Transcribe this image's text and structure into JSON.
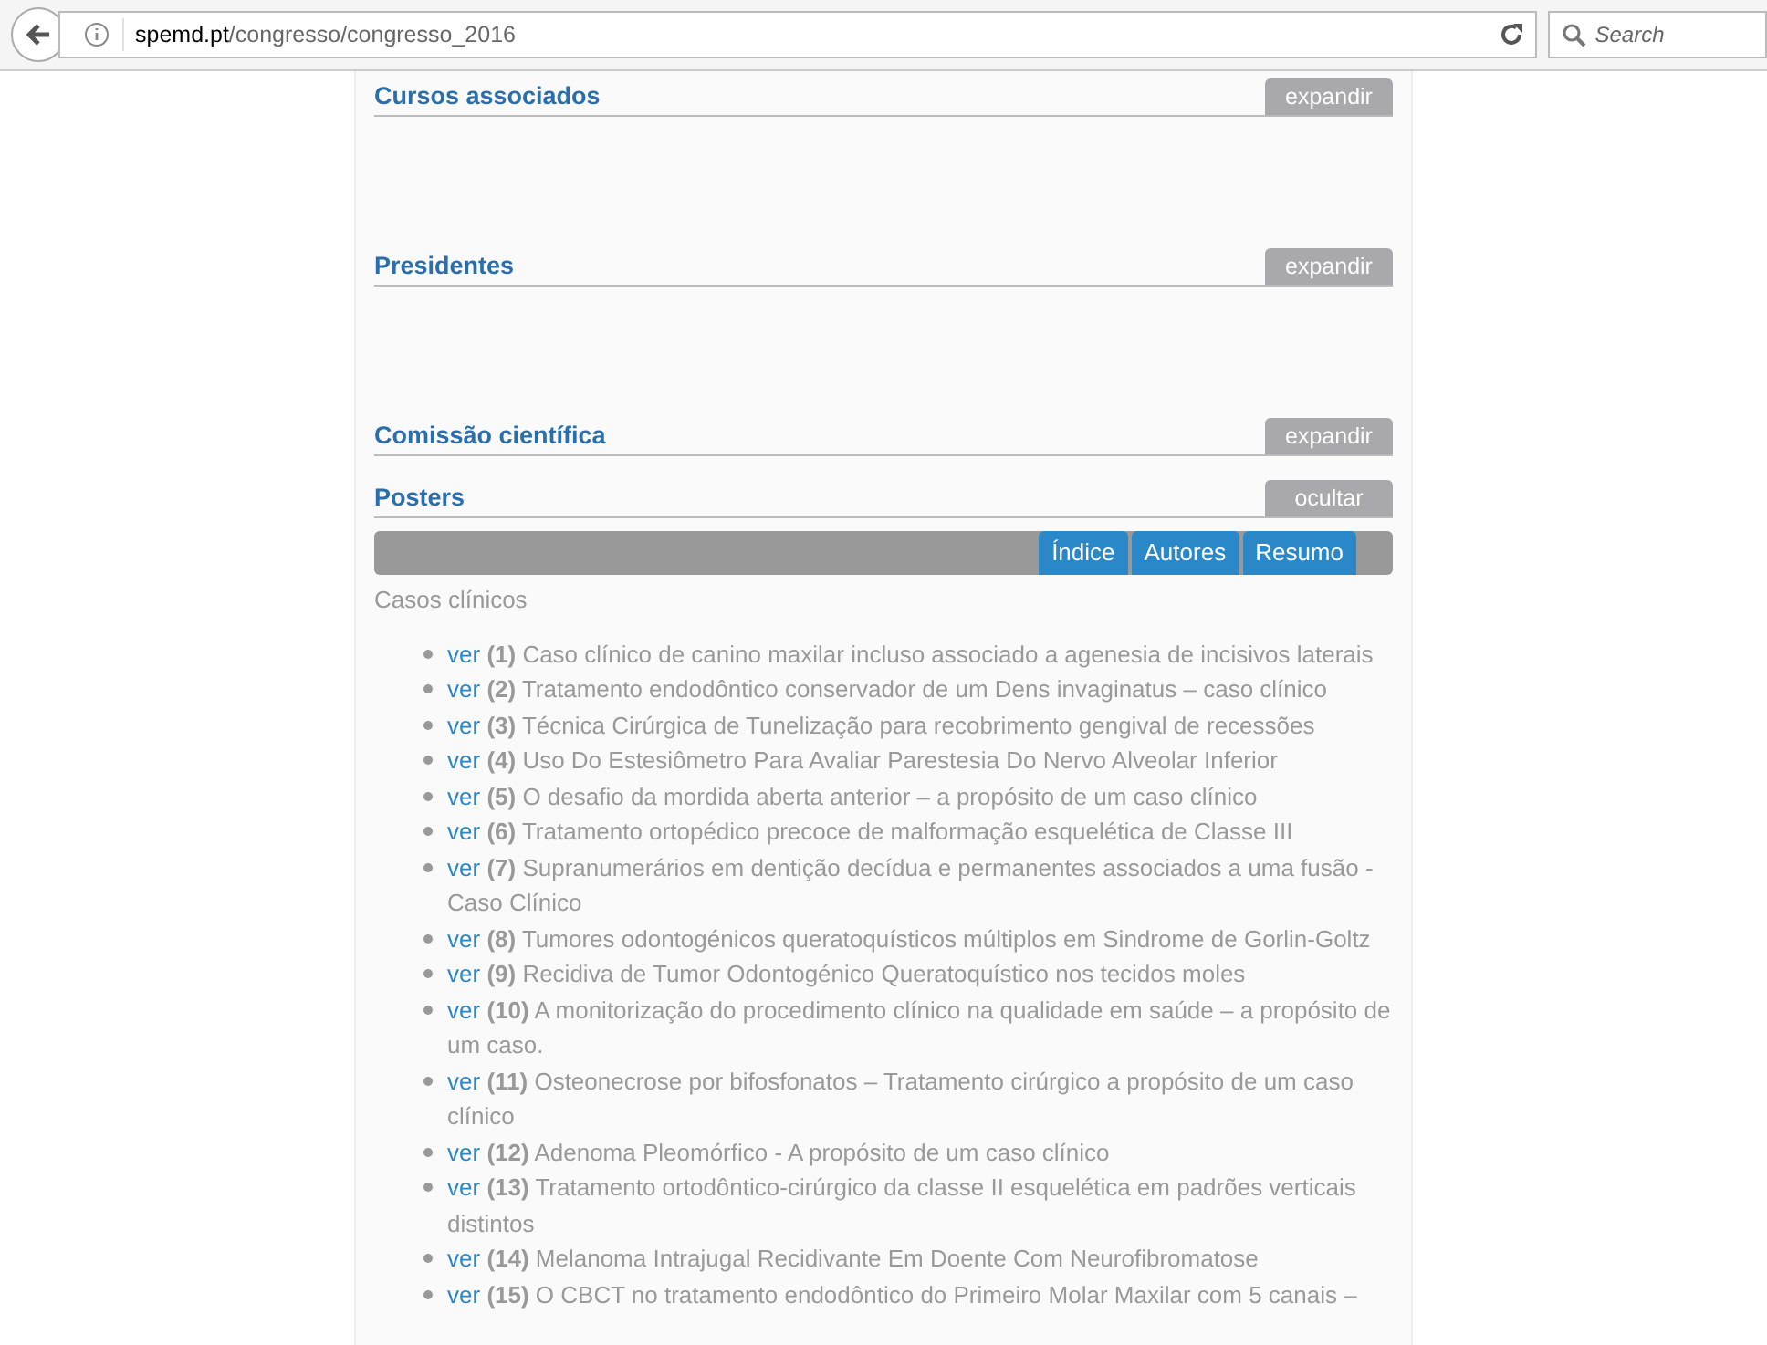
{
  "browser": {
    "url_domain": "spemd.pt",
    "url_path": "/congresso/congresso_2016",
    "search": {
      "placeholder": "Search"
    }
  },
  "sections": [
    {
      "title": "Cursos associados",
      "toggle": "expandir"
    },
    {
      "title": "Presidentes",
      "toggle": "expandir"
    },
    {
      "title": "Comissão científica",
      "toggle": "expandir"
    },
    {
      "title": "Posters",
      "toggle": "ocultar"
    }
  ],
  "poster_tabs": [
    "Índice",
    "Autores",
    "Resumo"
  ],
  "category": "Casos clínicos",
  "posters": [
    {
      "link": "ver",
      "number": "(1)",
      "title": "Caso clínico de canino maxilar incluso associado a agenesia de incisivos laterais"
    },
    {
      "link": "ver",
      "number": "(2)",
      "title": "Tratamento endodôntico conservador de um Dens invaginatus – caso clínico"
    },
    {
      "link": "ver",
      "number": "(3)",
      "title": "Técnica Cirúrgica de Tunelização para recobrimento gengival de recessões"
    },
    {
      "link": "ver",
      "number": "(4)",
      "title": "Uso Do Estesiômetro Para Avaliar Parestesia Do Nervo Alveolar Inferior"
    },
    {
      "link": "ver",
      "number": "(5)",
      "title": "O desafio da mordida aberta anterior – a propósito de um caso clínico"
    },
    {
      "link": "ver",
      "number": "(6)",
      "title": "Tratamento ortopédico precoce de malformação esquelética de Classe III"
    },
    {
      "link": "ver",
      "number": "(7)",
      "title": "Supranumerários em dentição decídua e permanentes associados a uma fusão - Caso Clínico"
    },
    {
      "link": "ver",
      "number": "(8)",
      "title": "Tumores odontogénicos queratoquísticos múltiplos em Sindrome de Gorlin-Goltz"
    },
    {
      "link": "ver",
      "number": "(9)",
      "title": "Recidiva de Tumor Odontogénico Queratoquístico nos tecidos moles"
    },
    {
      "link": "ver",
      "number": "(10)",
      "title": "A monitorização do procedimento clínico na qualidade em saúde – a propósito de um caso."
    },
    {
      "link": "ver",
      "number": "(11)",
      "title": "Osteonecrose por bifosfonatos – Tratamento cirúrgico a propósito de um caso clínico"
    },
    {
      "link": "ver",
      "number": "(12)",
      "title": "Adenoma Pleomórfico - A propósito de um caso clínico"
    },
    {
      "link": "ver",
      "number": "(13)",
      "title": "Tratamento ortodôntico-cirúrgico da classe II esquelética em padrões verticais distintos"
    },
    {
      "link": "ver",
      "number": "(14)",
      "title": "Melanoma Intrajugal Recidivante Em Doente Com Neurofibromatose"
    },
    {
      "link": "ver",
      "number": "(15)",
      "title": "O CBCT no tratamento endodôntico do Primeiro Molar Maxilar com 5 canais –"
    }
  ]
}
